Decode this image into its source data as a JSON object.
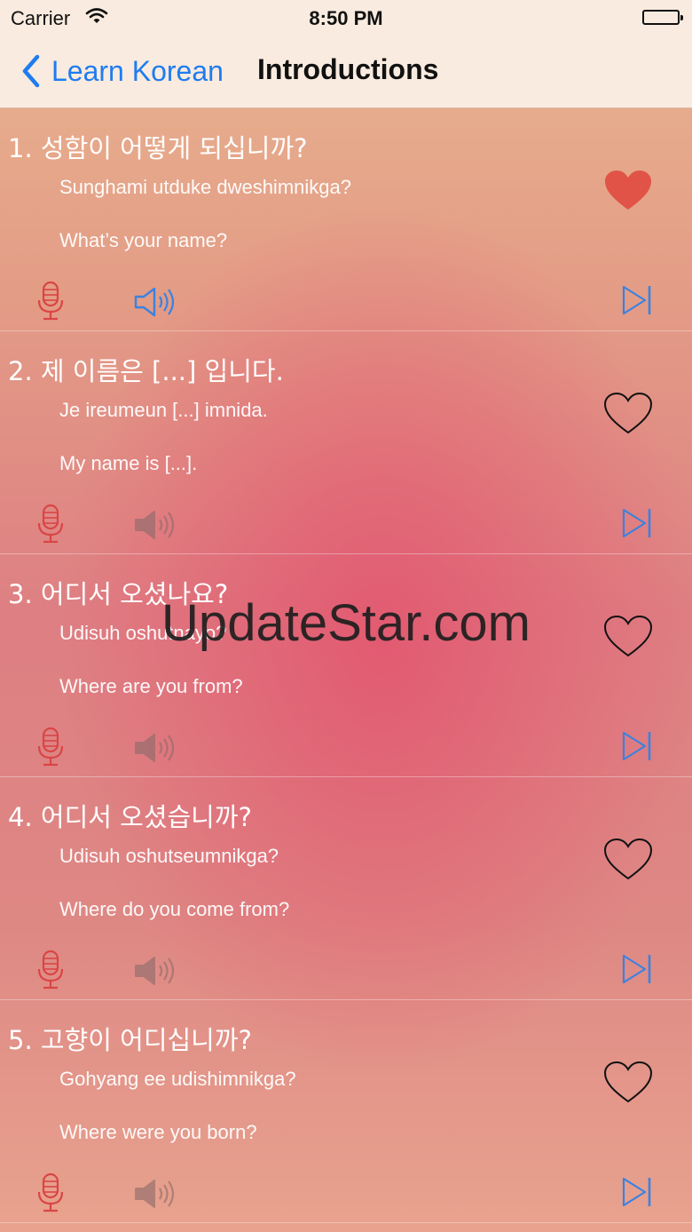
{
  "status_bar": {
    "carrier": "Carrier",
    "time": "8:50 PM"
  },
  "nav": {
    "back_label": "Learn Korean",
    "title": "Introductions"
  },
  "colors": {
    "accent": "#1f7cf0",
    "favorite": "#e05346",
    "mic": "#d94545"
  },
  "phrases": [
    {
      "korean": "1. 성함이 어떻게 되십니까?",
      "romanization": "Sunghami utduke dweshimnikga?",
      "english": "What’s your name?",
      "favorite": true,
      "audio_active": true
    },
    {
      "korean": "2. 제 이름은 [...] 입니다.",
      "romanization": "Je ireumeun [...] imnida.",
      "english": "My name is [...].",
      "favorite": false,
      "audio_active": false
    },
    {
      "korean": "3. 어디서 오셨나요?",
      "romanization": "Udisuh oshutnayo?",
      "english": "Where are you from?",
      "favorite": false,
      "audio_active": false
    },
    {
      "korean": "4. 어디서 오셨습니까?",
      "romanization": "Udisuh oshutseumnikga?",
      "english": "Where do you come from?",
      "favorite": false,
      "audio_active": false
    },
    {
      "korean": "5. 고향이 어디십니까?",
      "romanization": "Gohyang ee udishimnikga?",
      "english": "Where were you born?",
      "favorite": false,
      "audio_active": false
    }
  ],
  "icons": {
    "favorite": "heart-icon",
    "record": "microphone-icon",
    "play": "speaker-icon",
    "next": "skip-next-icon"
  },
  "watermark": "UpdateStar.com"
}
